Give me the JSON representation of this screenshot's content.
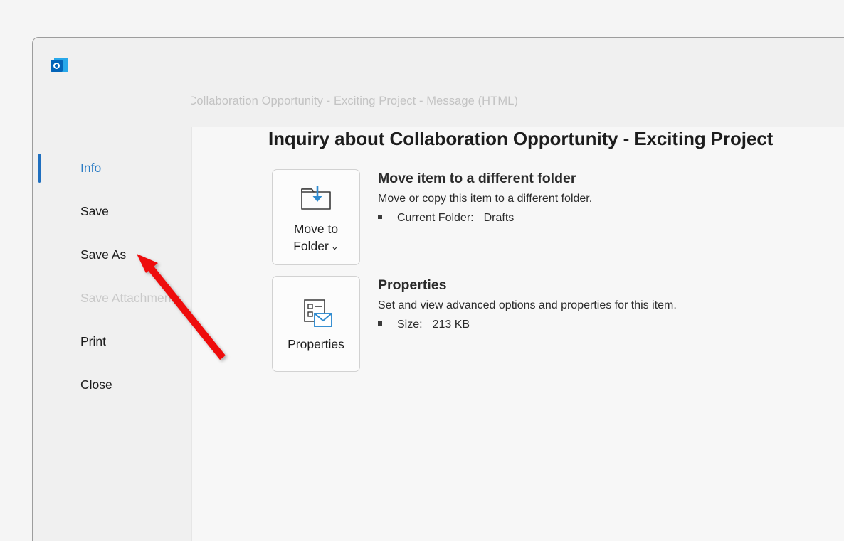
{
  "window": {
    "app_icon": "outlook-icon",
    "title": "Inquiry about Collaboration Opportunity - Exciting Project  -  Message (HTML)",
    "back_button_icon": "back-arrow-icon"
  },
  "sidebar": {
    "items": [
      {
        "label": "Info",
        "state": "selected"
      },
      {
        "label": "Save",
        "state": "normal"
      },
      {
        "label": "Save As",
        "state": "normal"
      },
      {
        "label": "Save Attachments",
        "state": "disabled"
      },
      {
        "label": "Print",
        "state": "normal"
      },
      {
        "label": "Close",
        "state": "normal"
      }
    ]
  },
  "content": {
    "title": "Inquiry about Collaboration Opportunity - Exciting Project",
    "sections": [
      {
        "button_label_line1": "Move to",
        "button_label_line2": "Folder",
        "button_chevron": "chevron-down-icon",
        "button_icon": "move-to-folder-icon",
        "heading": "Move item to a different folder",
        "description": "Move or copy this item to a different folder.",
        "detail_key": "Current Folder:",
        "detail_value": "Drafts"
      },
      {
        "button_label_line1": "Properties",
        "button_icon": "properties-icon",
        "heading": "Properties",
        "description": "Set and view advanced options and properties for this item.",
        "detail_key": "Size:",
        "detail_value": "213 KB"
      }
    ]
  },
  "annotation": {
    "arrow_color": "#ee1111",
    "points_to": "Save As"
  },
  "colors": {
    "accent_blue": "#1f6fbf",
    "selected_text_blue": "#2b7cc4",
    "icon_blue": "#2e8bd0",
    "window_bg": "#f0f0f0",
    "panel_bg": "#f7f7f7",
    "page_bg": "#f5f5f5",
    "title_grey": "#c3c3c3",
    "disabled_grey": "#c9c9c9"
  }
}
